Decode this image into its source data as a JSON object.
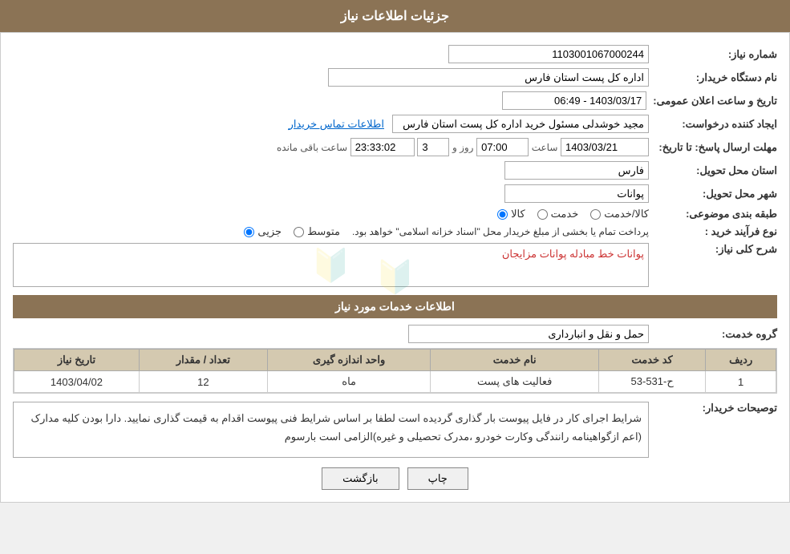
{
  "header": {
    "title": "جزئیات اطلاعات نیاز"
  },
  "fields": {
    "order_number_label": "شماره نیاز:",
    "order_number_value": "1103001067000244",
    "buyer_org_label": "نام دستگاه خریدار:",
    "buyer_org_value": "اداره کل پست استان فارس",
    "announce_date_label": "تاریخ و ساعت اعلان عمومی:",
    "announce_date_value": "1403/03/17 - 06:49",
    "creator_label": "ایجاد کننده درخواست:",
    "creator_value": "مجید خوشدلی مسئول خرید اداره کل پست استان فارس",
    "contact_link": "اطلاعات تماس خریدار",
    "deadline_label": "مهلت ارسال پاسخ: تا تاریخ:",
    "deadline_date": "1403/03/21",
    "deadline_time_label": "ساعت",
    "deadline_time": "07:00",
    "deadline_day_label": "روز و",
    "deadline_days": "3",
    "deadline_remaining_label": "ساعت باقی مانده",
    "deadline_remaining": "23:33:02",
    "province_label": "استان محل تحویل:",
    "province_value": "فارس",
    "city_label": "شهر محل تحویل:",
    "city_value": "پوانات",
    "category_label": "طبقه بندی موضوعی:",
    "category_radio1": "کالا",
    "category_radio2": "خدمت",
    "category_radio3": "کالا/خدمت",
    "purchase_type_label": "نوع فرآیند خرید :",
    "purchase_radio1": "جزیی",
    "purchase_radio2": "متوسط",
    "purchase_note": "پرداخت تمام یا بخشی از مبلغ خریدار محل \"اسناد خزانه اسلامی\" خواهد بود.",
    "description_label": "شرح کلی نیاز:",
    "description_value": "پوانات خط مبادله پوانات مزایجان",
    "services_section": "اطلاعات خدمات مورد نیاز",
    "service_group_label": "گروه خدمت:",
    "service_group_value": "حمل و نقل و انبارداری",
    "table": {
      "headers": [
        "ردیف",
        "کد خدمت",
        "نام خدمت",
        "واحد اندازه گیری",
        "تعداد / مقدار",
        "تاریخ نیاز"
      ],
      "rows": [
        {
          "row": "1",
          "code": "ح-531-53",
          "name": "فعالیت های پست",
          "unit": "ماه",
          "quantity": "12",
          "date": "1403/04/02"
        }
      ]
    },
    "buyer_notes_label": "توصیحات خریدار:",
    "buyer_notes": "شرایط اجرای کار در فایل پیوست بار گذاری گردیده است لطفا بر اساس شرایط فنی پیوست اقدام به قیمت گذاری نمایید. دارا بودن کلیه مدارک (اعم ازگواهینامه رانندگی وکارت خودرو ،مدرک تحصیلی و غیره)الزامی است بارسوم"
  },
  "buttons": {
    "back_label": "بازگشت",
    "print_label": "چاپ"
  }
}
